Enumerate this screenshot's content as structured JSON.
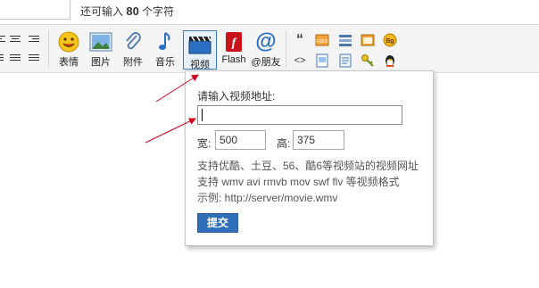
{
  "counter": {
    "prefix": "还可输入",
    "count": "80",
    "suffix": "个字符"
  },
  "toolbar": {
    "tools": [
      {
        "label": "表情",
        "icon": "smiley-icon"
      },
      {
        "label": "图片",
        "icon": "picture-icon"
      },
      {
        "label": "附件",
        "icon": "paperclip-icon"
      },
      {
        "label": "音乐",
        "icon": "music-note-icon"
      },
      {
        "label": "视频",
        "icon": "video-clapper-icon"
      },
      {
        "label": "Flash",
        "icon": "flash-icon"
      },
      {
        "label": "@朋友",
        "icon": "at-friend-icon"
      }
    ],
    "mini_quote": "“",
    "mini_code": "<>",
    "mini_free": "FREE",
    "mini_bg": "Bg"
  },
  "popup": {
    "title": "请输入视频地址:",
    "url_value": "",
    "width_label": "宽:",
    "width_value": "500",
    "height_label": "高:",
    "height_value": "375",
    "help_line1": "支持优酷、土豆、56、酷6等视频站的视频网址",
    "help_line2": "支持 wmv avi rmvb mov swf flv 等视频格式",
    "help_line3": "示例: http://server/movie.wmv",
    "submit_label": "提交"
  },
  "colors": {
    "accent": "#2f6fb7",
    "arrow": "#d0021b"
  }
}
